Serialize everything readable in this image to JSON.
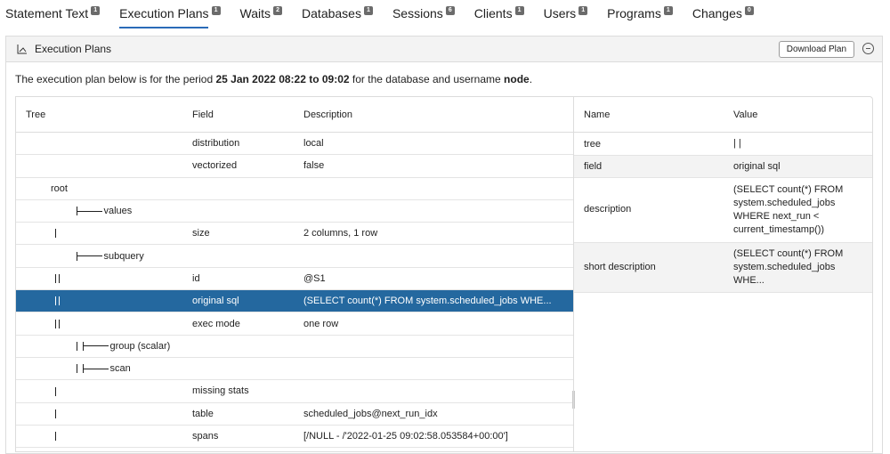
{
  "tabs": [
    {
      "label": "Statement Text",
      "badge": "1"
    },
    {
      "label": "Execution Plans",
      "badge": "1"
    },
    {
      "label": "Waits",
      "badge": "2"
    },
    {
      "label": "Databases",
      "badge": "1"
    },
    {
      "label": "Sessions",
      "badge": "6"
    },
    {
      "label": "Clients",
      "badge": "1"
    },
    {
      "label": "Users",
      "badge": "1"
    },
    {
      "label": "Programs",
      "badge": "1"
    },
    {
      "label": "Changes",
      "badge": "0"
    }
  ],
  "panel": {
    "title": "Execution Plans",
    "download_label": "Download Plan",
    "intro_prefix": "The execution plan below is for the period ",
    "intro_period": "25 Jan 2022 08:22 to 09:02",
    "intro_middle": " for the database and username ",
    "intro_user": "node",
    "intro_suffix": "."
  },
  "plan_table": {
    "headers": {
      "tree": "Tree",
      "field": "Field",
      "description": "Description"
    },
    "rows": [
      {
        "tree": "",
        "field": "distribution",
        "description": "local"
      },
      {
        "tree": "",
        "field": "vectorized",
        "description": "false"
      },
      {
        "tree": "root",
        "field": "",
        "description": ""
      },
      {
        "tree": "values",
        "field": "",
        "description": ""
      },
      {
        "tree": "",
        "field": "size",
        "description": "2 columns, 1 row"
      },
      {
        "tree": "subquery",
        "field": "",
        "description": ""
      },
      {
        "tree": "",
        "field": "id",
        "description": "@S1"
      },
      {
        "tree": "",
        "field": "original sql",
        "description": "(SELECT count(*) FROM system.scheduled_jobs WHE..."
      },
      {
        "tree": "",
        "field": "exec mode",
        "description": "one row"
      },
      {
        "tree": "group (scalar)",
        "field": "",
        "description": ""
      },
      {
        "tree": "scan",
        "field": "",
        "description": ""
      },
      {
        "tree": "",
        "field": "missing stats",
        "description": ""
      },
      {
        "tree": "",
        "field": "table",
        "description": "scheduled_jobs@next_run_idx"
      },
      {
        "tree": "",
        "field": "spans",
        "description": "[/NULL - /'2022-01-25 09:02:58.053584+00:00']"
      }
    ]
  },
  "detail_table": {
    "headers": {
      "name": "Name",
      "value": "Value"
    },
    "rows": [
      {
        "name": "tree",
        "value": "| |"
      },
      {
        "name": "field",
        "value": "original sql"
      },
      {
        "name": "description",
        "value": "(SELECT count(*) FROM\nsystem.scheduled_jobs\nWHERE next_run <\ncurrent_timestamp())"
      },
      {
        "name": "short description",
        "value": "(SELECT count(*) FROM\nsystem.scheduled_jobs\nWHE..."
      }
    ]
  },
  "colors": {
    "selected_row": "#24689f",
    "active_tab_underline": "#2a6bb8"
  }
}
